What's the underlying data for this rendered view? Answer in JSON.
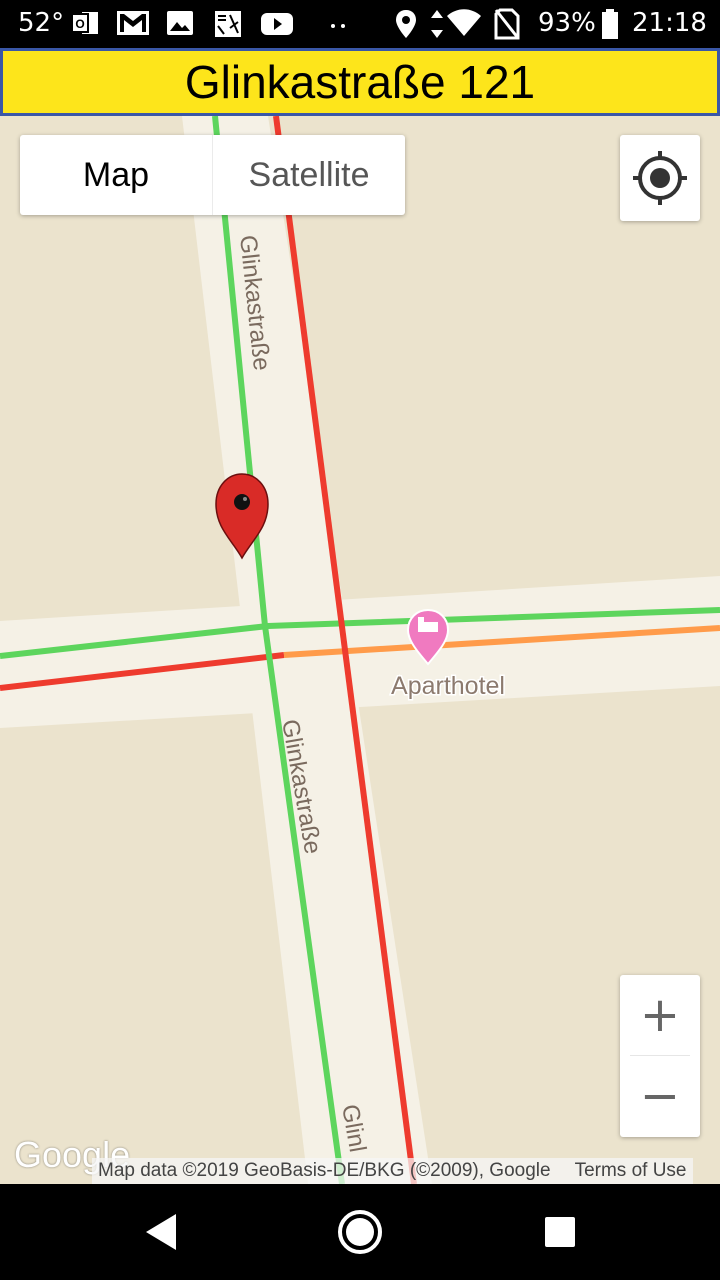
{
  "status_bar": {
    "temperature": "52°",
    "battery": "93%",
    "time": "21:18",
    "icons": [
      "outlook-icon",
      "gmail-icon",
      "photos-icon",
      "news-icon",
      "youtube-icon",
      "more-icon",
      "location-icon",
      "data-arrows-icon",
      "wifi-icon",
      "no-sim-icon",
      "battery-icon"
    ]
  },
  "title_bar": {
    "title": "Glinkastraße 121",
    "background": "#fde51b",
    "border": "#3a57a7"
  },
  "map": {
    "map_type": {
      "map_label": "Map",
      "satellite_label": "Satellite",
      "selected": "Map"
    },
    "street_labels": [
      "Glinkastraße",
      "Glinkastraße",
      "Glinl"
    ],
    "poi": {
      "name": "Aparthotel",
      "icon": "hotel-icon",
      "color": "#f07ac0"
    },
    "traffic_colors": {
      "free": "#5dd55d",
      "slow": "#ff9b4a",
      "jam": "#ee3b2e"
    },
    "marker": {
      "icon": "red-pin-icon",
      "color": "#d92b27"
    },
    "zoom_in_label": "+",
    "zoom_out_label": "−",
    "google_logo": "Google",
    "attribution": "Map data ©2019 GeoBasis-DE/BKG (©2009), Google",
    "terms": "Terms of Use"
  },
  "nav_bar": {
    "buttons": [
      "back-icon",
      "home-icon",
      "recents-icon"
    ]
  }
}
